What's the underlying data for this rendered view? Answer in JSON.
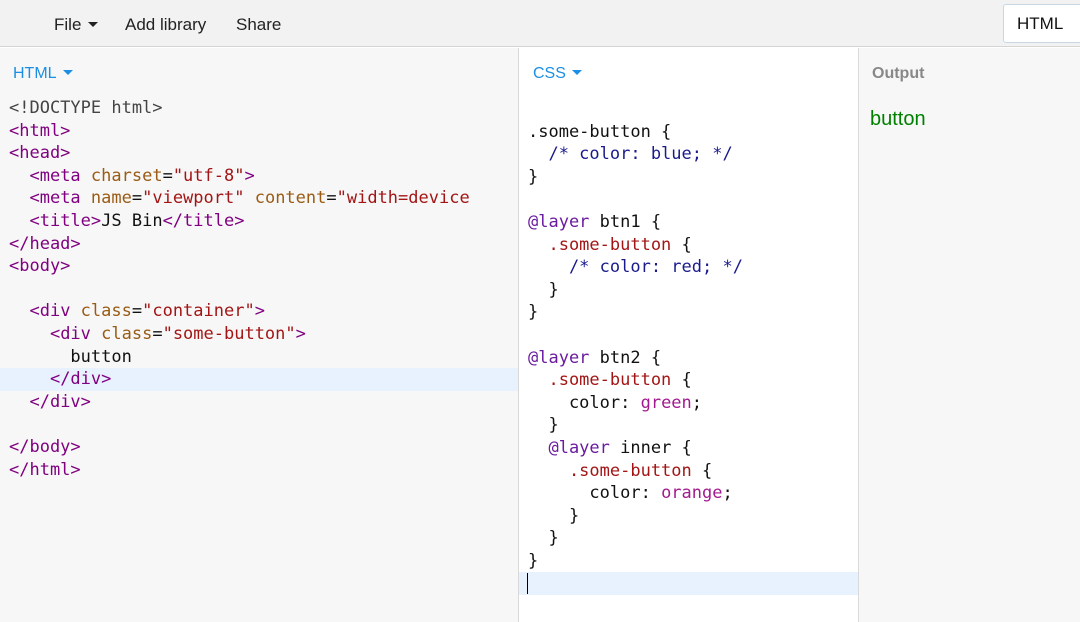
{
  "toolbar": {
    "file_label": "File",
    "add_library_label": "Add library",
    "share_label": "Share",
    "panel_toggle_label": "HTML"
  },
  "html_panel": {
    "label": "HTML",
    "lines": [
      [
        {
          "t": "doc",
          "v": "<!DOCTYPE html>"
        }
      ],
      [
        {
          "t": "tag",
          "v": "<html>"
        }
      ],
      [
        {
          "t": "tag",
          "v": "<head>"
        }
      ],
      [
        {
          "t": "text",
          "v": "  "
        },
        {
          "t": "tag",
          "v": "<meta "
        },
        {
          "t": "attr",
          "v": "charset"
        },
        {
          "t": "text",
          "v": "="
        },
        {
          "t": "str",
          "v": "\"utf-8\""
        },
        {
          "t": "tag",
          "v": ">"
        }
      ],
      [
        {
          "t": "text",
          "v": "  "
        },
        {
          "t": "tag",
          "v": "<meta "
        },
        {
          "t": "attr",
          "v": "name"
        },
        {
          "t": "text",
          "v": "="
        },
        {
          "t": "str",
          "v": "\"viewport\""
        },
        {
          "t": "text",
          "v": " "
        },
        {
          "t": "attr",
          "v": "content"
        },
        {
          "t": "text",
          "v": "="
        },
        {
          "t": "str",
          "v": "\"width=device"
        }
      ],
      [
        {
          "t": "text",
          "v": "  "
        },
        {
          "t": "tag",
          "v": "<title>"
        },
        {
          "t": "text",
          "v": "JS Bin"
        },
        {
          "t": "tag",
          "v": "</title>"
        }
      ],
      [
        {
          "t": "tag",
          "v": "</head>"
        }
      ],
      [
        {
          "t": "tag",
          "v": "<body>"
        }
      ],
      [
        {
          "t": "text",
          "v": ""
        }
      ],
      [
        {
          "t": "text",
          "v": "  "
        },
        {
          "t": "tag",
          "v": "<div "
        },
        {
          "t": "attr",
          "v": "class"
        },
        {
          "t": "text",
          "v": "="
        },
        {
          "t": "str",
          "v": "\"container\""
        },
        {
          "t": "tag",
          "v": ">"
        }
      ],
      [
        {
          "t": "text",
          "v": "    "
        },
        {
          "t": "tag",
          "v": "<div "
        },
        {
          "t": "attr",
          "v": "class"
        },
        {
          "t": "text",
          "v": "="
        },
        {
          "t": "str",
          "v": "\"some-button\""
        },
        {
          "t": "tag",
          "v": ">"
        }
      ],
      [
        {
          "t": "text",
          "v": "      button"
        }
      ],
      [
        {
          "t": "text",
          "v": "    "
        },
        {
          "t": "tag",
          "v": "</div>"
        }
      ],
      [
        {
          "t": "text",
          "v": "  "
        },
        {
          "t": "tag",
          "v": "</div>"
        }
      ],
      [
        {
          "t": "text",
          "v": ""
        }
      ],
      [
        {
          "t": "tag",
          "v": "</body>"
        }
      ],
      [
        {
          "t": "tag",
          "v": "</html>"
        }
      ]
    ],
    "active_line": 12
  },
  "css_panel": {
    "label": "CSS",
    "lines": [
      [
        {
          "t": "text",
          "v": ""
        }
      ],
      [
        {
          "t": "punc",
          "v": ".some-button {"
        }
      ],
      [
        {
          "t": "com",
          "v": "  /* color: blue; */"
        }
      ],
      [
        {
          "t": "punc",
          "v": "}"
        }
      ],
      [
        {
          "t": "text",
          "v": ""
        }
      ],
      [
        {
          "t": "at",
          "v": "@layer"
        },
        {
          "t": "punc",
          "v": " btn1 {"
        }
      ],
      [
        {
          "t": "sel",
          "v": "  .some-button"
        },
        {
          "t": "punc",
          "v": " {"
        }
      ],
      [
        {
          "t": "com",
          "v": "    /* color: red; */"
        }
      ],
      [
        {
          "t": "punc",
          "v": "  }"
        }
      ],
      [
        {
          "t": "punc",
          "v": "}"
        }
      ],
      [
        {
          "t": "text",
          "v": ""
        }
      ],
      [
        {
          "t": "at",
          "v": "@layer"
        },
        {
          "t": "punc",
          "v": " btn2 {"
        }
      ],
      [
        {
          "t": "sel",
          "v": "  .some-button"
        },
        {
          "t": "punc",
          "v": " {"
        }
      ],
      [
        {
          "t": "prop",
          "v": "    color: "
        },
        {
          "t": "val",
          "v": "green"
        },
        {
          "t": "punc",
          "v": ";"
        }
      ],
      [
        {
          "t": "punc",
          "v": "  }"
        }
      ],
      [
        {
          "t": "at",
          "v": "  @layer"
        },
        {
          "t": "punc",
          "v": " inner {"
        }
      ],
      [
        {
          "t": "sel",
          "v": "    .some-button"
        },
        {
          "t": "punc",
          "v": " {"
        }
      ],
      [
        {
          "t": "prop",
          "v": "      color: "
        },
        {
          "t": "val",
          "v": "orange"
        },
        {
          "t": "punc",
          "v": ";"
        }
      ],
      [
        {
          "t": "punc",
          "v": "    }"
        }
      ],
      [
        {
          "t": "punc",
          "v": "  }"
        }
      ],
      [
        {
          "t": "punc",
          "v": "}"
        }
      ],
      [
        {
          "t": "text",
          "v": ""
        }
      ]
    ],
    "active_line": 21
  },
  "output_panel": {
    "label": "Output",
    "button_text": "button"
  },
  "colors": {
    "accent": "#1a8fe3",
    "output_text": "#008000"
  }
}
